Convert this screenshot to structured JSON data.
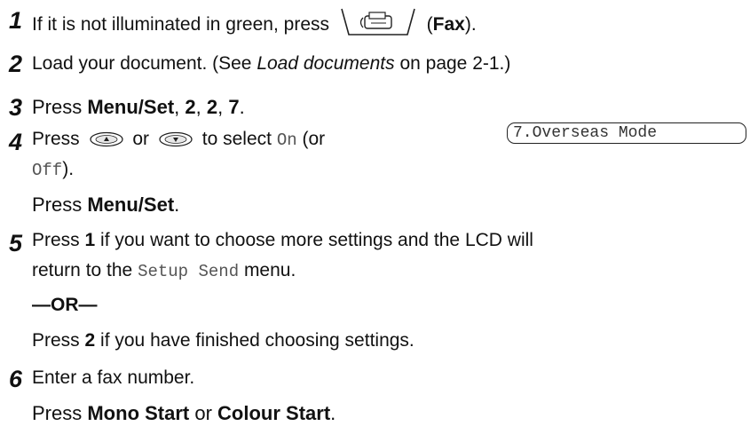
{
  "steps": [
    {
      "num": "1",
      "text_before": "If it is not illuminated in green, press",
      "key_label": "Fax",
      "text_after": ")."
    },
    {
      "num": "2",
      "text_before": "Load your document. (See ",
      "ref": "Load documents",
      "text_after": " on page 2-1.)"
    },
    {
      "num": "3",
      "text_before": "Press ",
      "key": "Menu/Set",
      "sep1": ", ",
      "k2": "2",
      "sep2": ", ",
      "k3": "2",
      "sep3": ", ",
      "k4": "7",
      "end": "."
    },
    {
      "num": "4",
      "press": "Press",
      "or": "or",
      "to_select": "to select",
      "on": "On",
      "or_open": "(or",
      "off": "Off",
      "close": ").",
      "press2": "Press ",
      "menu_set": "Menu/Set",
      "period": "."
    },
    {
      "num": "5",
      "press": "Press ",
      "key": "1",
      "text1": " if you want to choose more settings and the LCD will",
      "text2": "return to the ",
      "menu": "Setup Send",
      "text3": " menu.",
      "or_line": "—OR—",
      "press2": "Press ",
      "key2": "2",
      "text4": " if you have finished choosing settings."
    },
    {
      "num": "6",
      "text": "Enter a fax number.",
      "press": "Press ",
      "mono_start": "Mono Start",
      "or": " or ",
      "colour_start": "Colour Start",
      "period": "."
    }
  ],
  "lcd": {
    "text": "7.Overseas Mode"
  },
  "icons": {
    "fax_key": "fax-machine-icon",
    "up_key": "up-arrow-key-icon",
    "down_key": "down-arrow-key-icon"
  }
}
